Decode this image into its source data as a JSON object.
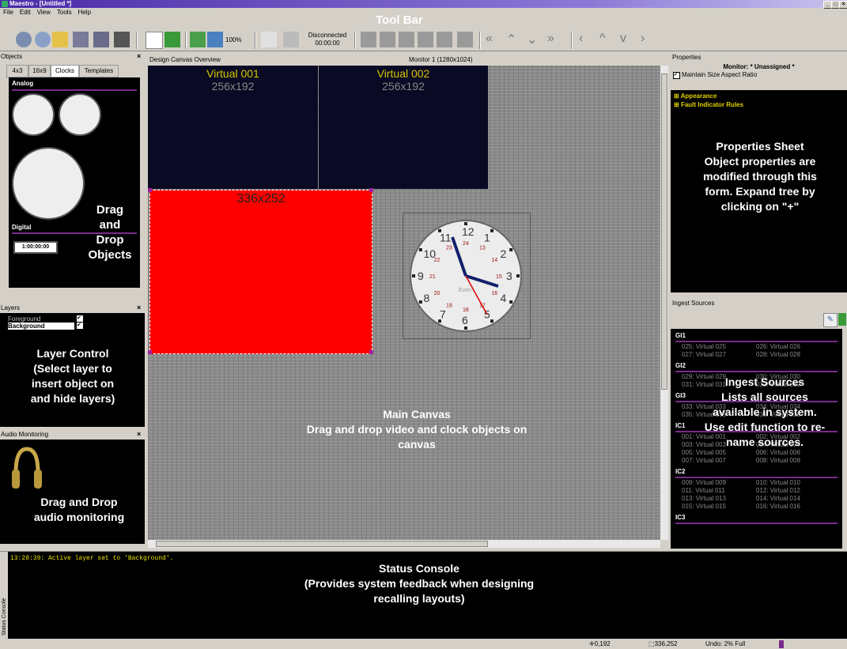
{
  "window": {
    "title": "Maestro - [Untitled *]"
  },
  "menu": [
    "File",
    "Edit",
    "View",
    "Tools",
    "Help"
  ],
  "toolbar": {
    "annotation": "Tool Bar",
    "zoom": "100%",
    "connection_status": "Disconnected",
    "connection_time": "00:00:00"
  },
  "objects_panel": {
    "title": "Objects",
    "tabs": [
      "4x3",
      "16x9",
      "Clocks",
      "Templates"
    ],
    "active_tab": "Clocks",
    "analog_heading": "Analog",
    "digital_heading": "Digital",
    "digital_clock_value": "1:00:00:00",
    "annotation": "Drag\nand\nDrop\nObjects"
  },
  "layers_panel": {
    "title": "Layers",
    "items": [
      {
        "label": "Foreground",
        "checked": true
      },
      {
        "label": "Background",
        "checked": true
      }
    ],
    "annotation": "Layer Control\n(Select layer  to\ninsert object on\nand hide layers)"
  },
  "audio_panel": {
    "title": "Audio Monitoring",
    "annotation": "Drag and Drop\naudio monitoring"
  },
  "canvas": {
    "header_left": "Design Canvas Overview",
    "header_center": "Monitor 1 (1280x1024)",
    "tiles": [
      {
        "name": "Virtual 001",
        "size": "256x192"
      },
      {
        "name": "Virtual 002",
        "size": "256x192"
      }
    ],
    "red_tile_size": "336x252",
    "annotation": "Main Canvas\nDrag and drop video and clock objects on\ncanvas",
    "clock_numbers": [
      "12",
      "1",
      "2",
      "3",
      "4",
      "5",
      "6",
      "7",
      "8",
      "9",
      "10",
      "11"
    ],
    "clock_inner": [
      "24",
      "13",
      "14",
      "15",
      "16",
      "17",
      "18",
      "19",
      "20",
      "21",
      "22",
      "23"
    ],
    "clock_label": "Even"
  },
  "properties_panel": {
    "title": "Properties",
    "monitor": "Monitor: * Unassigned *",
    "checkbox_label": "Maintain Size Aspect Ratio",
    "tree": [
      "Appearance",
      "Fault Indicator Rules"
    ],
    "annotation": "Properties Sheet\nObject properties are\nmodified through this\nform.  Expand tree by\nclicking on \"+\""
  },
  "ingest_panel": {
    "title": "Ingest Sources",
    "groups": [
      {
        "name": "GI1",
        "sources": [
          "025: Virtual 025",
          "026: Virtual 026",
          "027: Virtual 027",
          "028: Virtual 028"
        ]
      },
      {
        "name": "GI2",
        "sources": [
          "029: Virtual 029",
          "030: Virtual 030",
          "031: Virtual 031",
          "032: Virtual 032"
        ]
      },
      {
        "name": "GI3",
        "sources": [
          "033: Virtual 033",
          "034: Virtual 034",
          "035: Virtual 035",
          "036: Virtual 036"
        ]
      },
      {
        "name": "IC1",
        "sources": [
          "001: Virtual 001",
          "002: Virtual 002",
          "003: Virtual 003",
          "004: Virtual 004",
          "005: Virtual 005",
          "006: Virtual 006",
          "007: Virtual 007",
          "008: Virtual 008"
        ]
      },
      {
        "name": "IC2",
        "sources": [
          "009: Virtual 009",
          "010: Virtual 010",
          "011: Virtual 011",
          "012: Virtual 012",
          "013: Virtual 013",
          "014: Virtual 014",
          "015: Virtual 015",
          "016: Virtual 016"
        ]
      },
      {
        "name": "IC3",
        "sources": []
      }
    ],
    "annotation": "Ingest Sources\nLists all sources\navailable in system.\nUse edit function to re-\nname sources."
  },
  "status_console": {
    "side_label": "Status Console",
    "log": "13:28:39: Active layer set to 'Background'.",
    "annotation": "Status Console\n(Provides system feedback when designing\nrecalling layouts)"
  },
  "statusbar": {
    "position": "0,192",
    "size": "336,252",
    "undo": "Undo: 2% Full"
  },
  "colors": {
    "accent": "#7a2a8a",
    "tile_name": "#d6c600",
    "red_tile": "#ff0000",
    "panel_bg": "#000000"
  }
}
